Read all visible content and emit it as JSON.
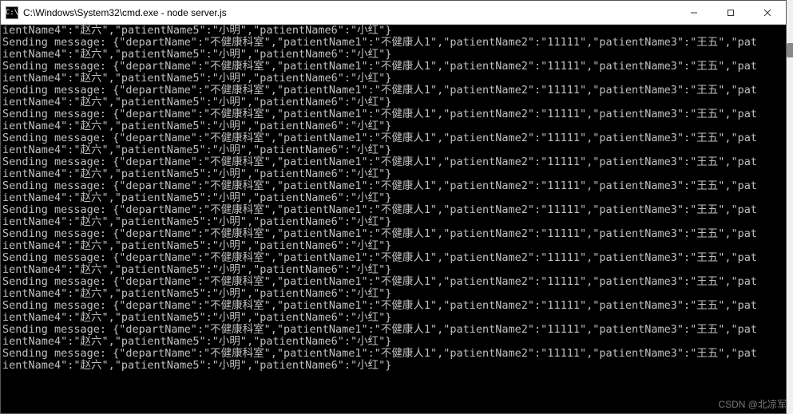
{
  "window": {
    "icon_label": "C:\\",
    "title": "C:\\Windows\\System32\\cmd.exe - node  server.js"
  },
  "buttons": {
    "minimize": "Minimize",
    "maximize": "Maximize",
    "close": "Close"
  },
  "console": {
    "prefix": "Sending message: ",
    "message_object": {
      "departName": "不健康科室",
      "patientName1": "不健康人1",
      "patientName2": "11111",
      "patientName3": "王五",
      "patientName4": "赵六",
      "patientName5": "小明",
      "patientName6": "小红"
    },
    "continuation_line": "ientName4\":\"赵六\",\"patientName5\":\"小明\",\"patientName6\":\"小红\"}",
    "full_first_line": "Sending message: {\"departName\":\"不健康科室\",\"patientName1\":\"不健康人1\",\"patientName2\":\"11111\",\"patientName3\":\"王五\",\"pat",
    "repeat_count": 14,
    "leading_partial": true
  },
  "watermark": "CSDN @北凉军"
}
